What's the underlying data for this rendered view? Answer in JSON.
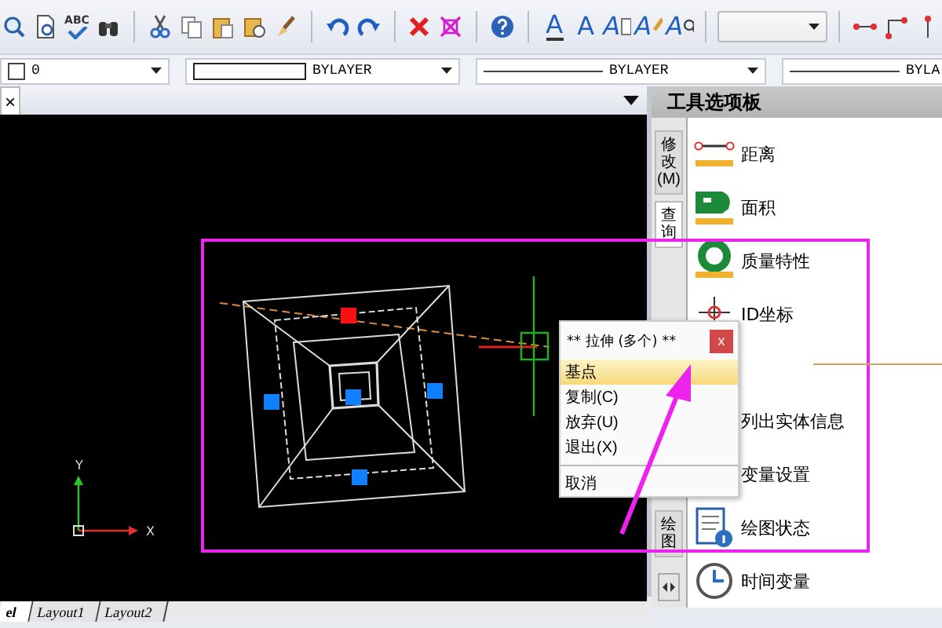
{
  "toolbar": [
    {
      "kind": "zoom"
    },
    {
      "kind": "print-preview"
    },
    {
      "kind": "spell-check",
      "glyph": "ABC"
    },
    {
      "kind": "find"
    },
    {
      "kind": "separator"
    },
    {
      "kind": "cut"
    },
    {
      "kind": "copy"
    },
    {
      "kind": "paste"
    },
    {
      "kind": "paste-special"
    },
    {
      "kind": "brush"
    },
    {
      "kind": "separator"
    },
    {
      "kind": "undo"
    },
    {
      "kind": "redo"
    },
    {
      "kind": "separator"
    },
    {
      "kind": "delete"
    },
    {
      "kind": "purge"
    },
    {
      "kind": "separator"
    },
    {
      "kind": "help"
    },
    {
      "kind": "separator"
    },
    {
      "kind": "text-underline",
      "glyph": "A"
    },
    {
      "kind": "text-plain",
      "glyph": "A"
    },
    {
      "kind": "text-edit",
      "glyph": "A"
    },
    {
      "kind": "text-brush",
      "glyph": "A"
    },
    {
      "kind": "text-find",
      "glyph": "A"
    },
    {
      "kind": "separator"
    },
    {
      "kind": "combo"
    },
    {
      "kind": "separator"
    },
    {
      "kind": "point-line"
    },
    {
      "kind": "corner-line"
    },
    {
      "kind": "pin"
    }
  ],
  "properties_bar": [
    {
      "kind": "layer",
      "value": "0"
    },
    {
      "kind": "color",
      "value": "BYLAYER"
    },
    {
      "kind": "linetype",
      "value": "BYLAYER"
    },
    {
      "kind": "lineweight",
      "value": "BYLA"
    }
  ],
  "drawing_tab": {
    "close": "×"
  },
  "canvas": {
    "ucs_y": "Y",
    "ucs_x": "X",
    "grips": [
      {
        "selected": true
      },
      {
        "selected": false
      },
      {
        "selected": false
      },
      {
        "selected": false
      },
      {
        "selected": false
      }
    ]
  },
  "layout_tabs": [
    {
      "label": "el",
      "selected": true
    },
    {
      "label": "Layout1",
      "selected": false
    },
    {
      "label": "Layout2",
      "selected": false
    }
  ],
  "tool_palette": {
    "title": "工具选项板",
    "side_tabs": [
      {
        "label": "修改(M)",
        "selected": false
      },
      {
        "label": "查询",
        "selected": true
      },
      {
        "label": "绘图",
        "selected": false
      }
    ],
    "items": [
      {
        "kind": "distance",
        "label": "距离"
      },
      {
        "kind": "area",
        "label": "面积"
      },
      {
        "kind": "mass",
        "label": "质量特性"
      },
      {
        "kind": "id-point",
        "label": "ID坐标"
      },
      {
        "kind": "list",
        "label": "列出实体信息"
      },
      {
        "kind": "variable",
        "label": "变量设置"
      },
      {
        "kind": "status",
        "label": "绘图状态"
      },
      {
        "kind": "time",
        "label": "时间变量"
      }
    ]
  },
  "context_menu": {
    "title": "** 拉伸 (多个) **",
    "close": "x",
    "items": [
      {
        "label": "基点",
        "selected": true
      },
      {
        "label": "复制(C)",
        "selected": false
      },
      {
        "label": "放弃(U)",
        "selected": false
      },
      {
        "label": "退出(X)",
        "selected": false
      },
      {
        "label": "取消",
        "selected": false
      }
    ]
  }
}
